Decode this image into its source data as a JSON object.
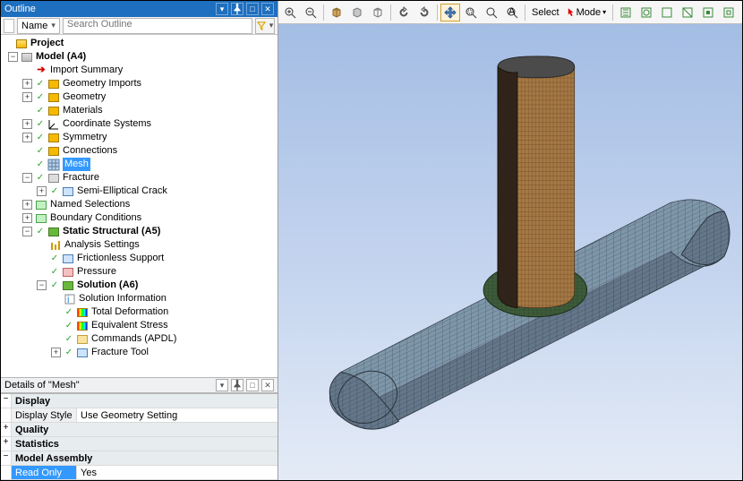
{
  "outline": {
    "title": "Outline",
    "name_label": "Name",
    "search_placeholder": "Search Outline",
    "tree": {
      "root": "Project",
      "model": "Model (A4)",
      "import_summary": "Import Summary",
      "geom_imports": "Geometry Imports",
      "geometry": "Geometry",
      "materials": "Materials",
      "coord_sys": "Coordinate Systems",
      "symmetry": "Symmetry",
      "connections": "Connections",
      "mesh": "Mesh",
      "fracture": "Fracture",
      "semi_ellip": "Semi-Elliptical Crack",
      "named_sel": "Named Selections",
      "bc": "Boundary Conditions",
      "static_struct": "Static Structural (A5)",
      "analysis_settings": "Analysis Settings",
      "friction_support": "Frictionless Support",
      "pressure": "Pressure",
      "solution": "Solution (A6)",
      "sol_info": "Solution Information",
      "total_deform": "Total Deformation",
      "equiv_stress": "Equivalent Stress",
      "commands": "Commands (APDL)",
      "fracture_tool": "Fracture Tool"
    }
  },
  "details": {
    "title": "Details of \"Mesh\"",
    "sections": {
      "display": "Display",
      "display_style_k": "Display Style",
      "display_style_v": "Use Geometry Setting",
      "quality": "Quality",
      "statistics": "Statistics",
      "model_assembly": "Model Assembly",
      "read_only_k": "Read Only",
      "read_only_v": "Yes"
    }
  },
  "viewport": {
    "select_label": "Select",
    "mode_label": "Mode"
  }
}
